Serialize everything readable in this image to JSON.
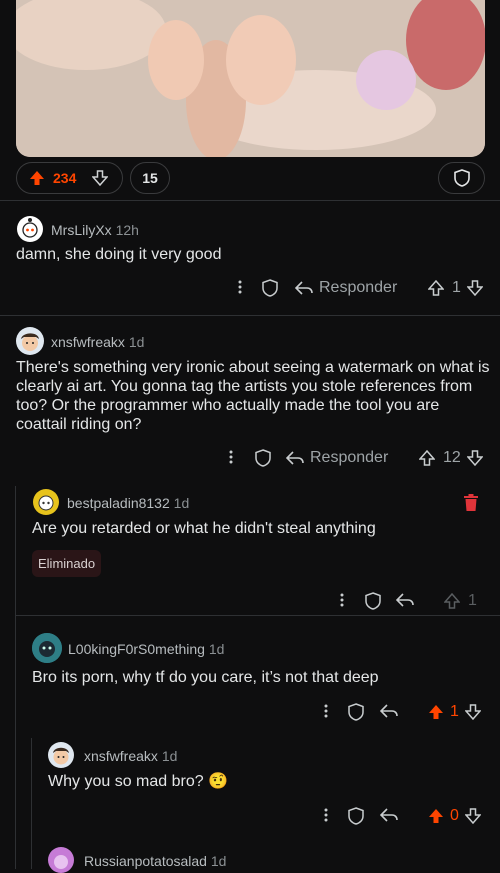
{
  "post": {
    "upvotes": "234",
    "comments": "15"
  },
  "comments": [
    {
      "user": "MrsLilyXx",
      "time": "12h",
      "text": "damn, she doing it very good",
      "reply_label": "Responder",
      "votes": "1"
    },
    {
      "user": "xnsfwfreakx",
      "time": "1d",
      "text": "There's something very ironic about seeing a watermark on what is clearly ai art. You gonna tag the artists you stole references from too? Or the programmer who actually made the tool you are coattail riding on?",
      "reply_label": "Responder",
      "votes": "12"
    },
    {
      "user": "bestpaladin8132",
      "time": "1d",
      "text": "Are you retarded or what he didn't steal anything",
      "badge": "Eliminado",
      "votes": "1"
    },
    {
      "user": "L00kingF0rS0mething",
      "time": "1d",
      "text": "Bro its porn, why tf do you care, it’s not that deep",
      "votes": "1"
    },
    {
      "user": "xnsfwfreakx",
      "time": "1d",
      "text": "Why you so mad bro? 🤨",
      "votes": "0"
    },
    {
      "user": "Russianpotatosalad",
      "time": "1d"
    }
  ],
  "colors": {
    "accent": "#ff4500",
    "danger": "#e0343a",
    "bg": "#0e0e0f"
  },
  "icons": [
    "upvote-icon",
    "downvote-icon",
    "shield-icon",
    "more-vertical-icon",
    "reply-icon",
    "trash-icon"
  ]
}
